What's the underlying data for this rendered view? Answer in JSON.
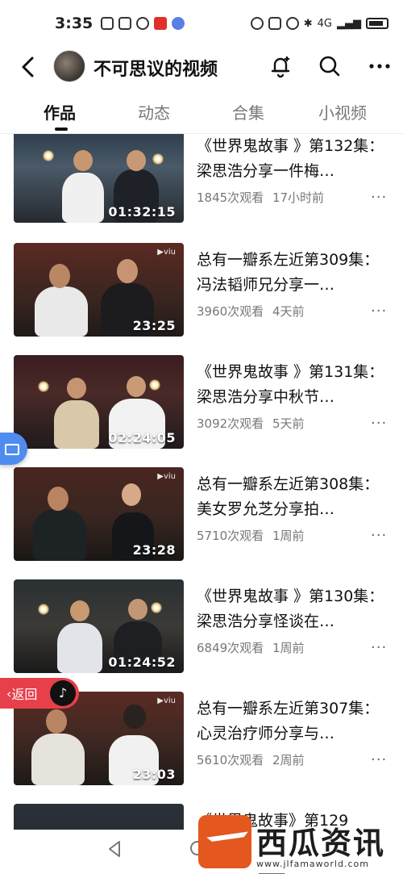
{
  "status_bar": {
    "time": "3:35",
    "network_label": "4G",
    "battery_label": ""
  },
  "header": {
    "back_icon": "chevron-left",
    "title": "不可思议的视频",
    "icons": [
      "bell-plus-icon",
      "search-icon",
      "more-horizontal-icon"
    ]
  },
  "tabs": [
    {
      "label": "作品",
      "active": true
    },
    {
      "label": "动态",
      "active": false
    },
    {
      "label": "合集",
      "active": false
    },
    {
      "label": "小视频",
      "active": false
    }
  ],
  "videos": [
    {
      "title": "《世界鬼故事 》第132集：梁思浩分享一件梅…",
      "duration": "01:32:15",
      "views": "1845次观看",
      "time": "17小时前"
    },
    {
      "title": "总有一瓣系左近第309集：冯法韬师兄分享一…",
      "duration": "23:25",
      "views": "3960次观看",
      "time": "4天前"
    },
    {
      "title": "《世界鬼故事 》第131集：梁思浩分享中秋节…",
      "duration": "02:24:05",
      "views": "3092次观看",
      "time": "5天前"
    },
    {
      "title": "总有一瓣系左近第308集：美女罗允芝分享拍…",
      "duration": "23:28",
      "views": "5710次观看",
      "time": "1周前"
    },
    {
      "title": "《世界鬼故事 》第130集：梁思浩分享怪谈在…",
      "duration": "01:24:52",
      "views": "6849次观看",
      "time": "1周前"
    },
    {
      "title": "总有一瓣系左近第307集：心灵治疗师分享与…",
      "duration": "23:03",
      "views": "5610次观看",
      "time": "2周前"
    },
    {
      "title": "《世界鬼故事》第129",
      "duration": "",
      "views": "",
      "time": ""
    }
  ],
  "return_pill": {
    "label": "返回"
  },
  "watermark": {
    "text": "西瓜资讯网",
    "url": "www.jlfamaworld.com"
  },
  "colors": {
    "accent_red": "#e8404a",
    "float_blue": "#4e8cf0",
    "watermark_orange": "#e4571f"
  }
}
